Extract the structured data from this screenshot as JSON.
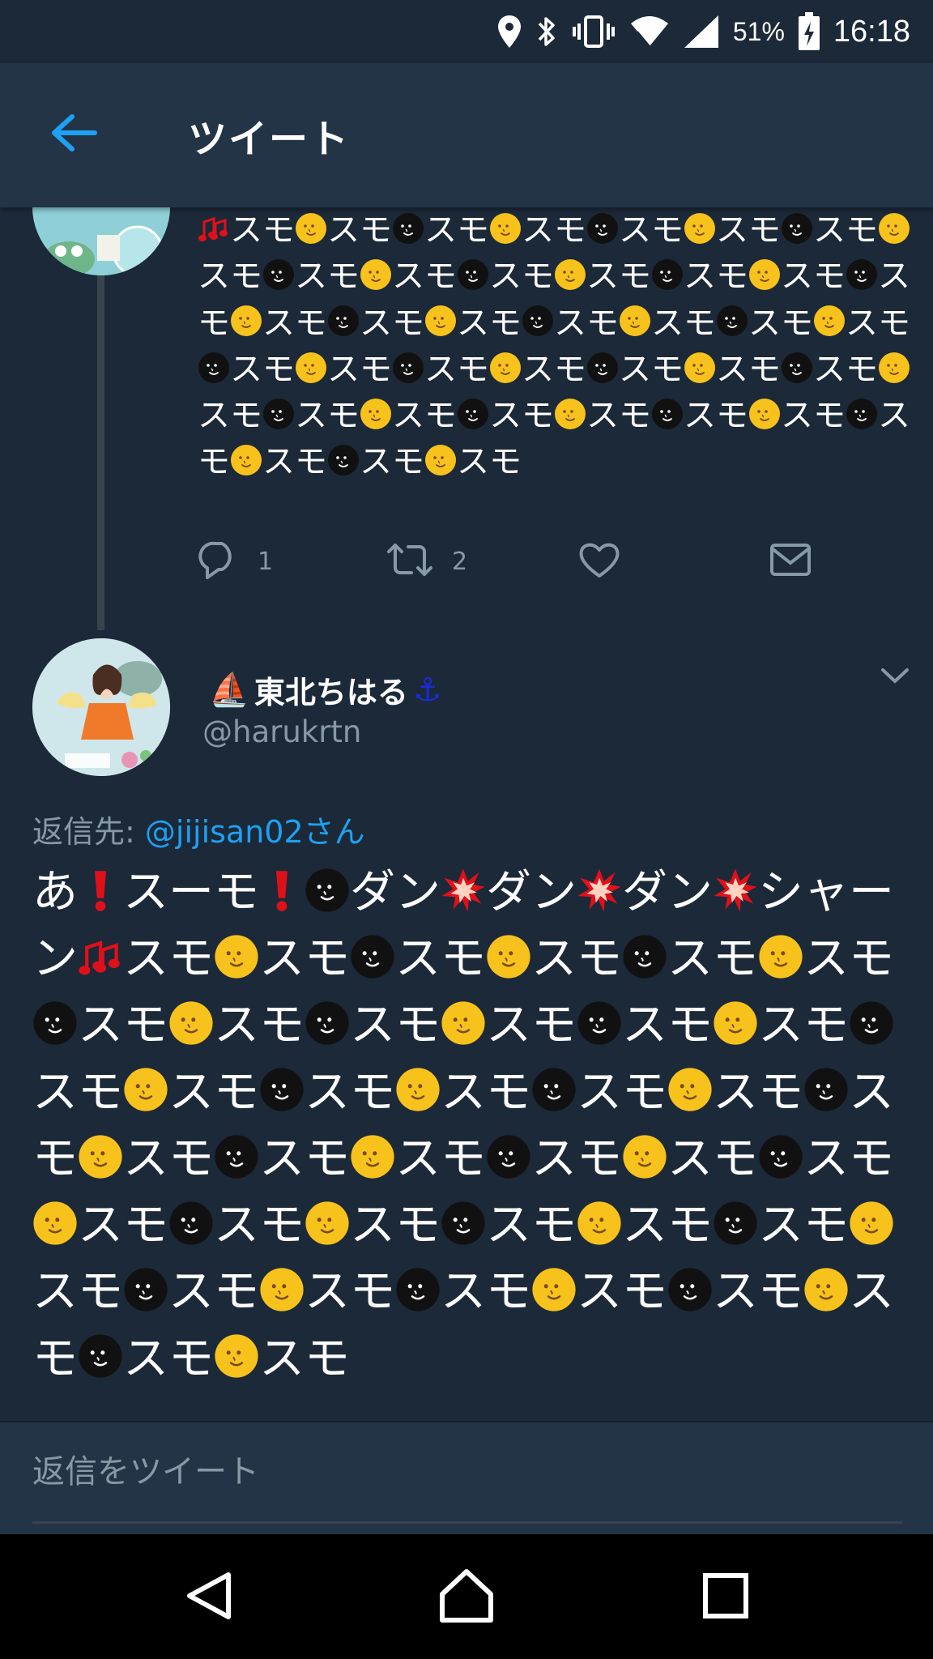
{
  "status_bar": {
    "battery_percent": "51%",
    "time": "16:18",
    "icons": [
      "location-icon",
      "bluetooth-icon",
      "vibrate-icon",
      "wifi-icon",
      "cell-signal-icon",
      "battery-charging-icon"
    ]
  },
  "app_bar": {
    "back_icon": "arrow-left-icon",
    "title": "ツイート"
  },
  "previous_tweet": {
    "text_tokens": [
      "🎶",
      "スモ",
      "🌝",
      "スモ",
      "🌚",
      "スモ",
      "🌝",
      "スモ",
      "🌚",
      "スモ",
      "🌝",
      "スモ",
      "🌚",
      "スモ",
      "🌝",
      "スモ",
      "🌚",
      "スモ",
      "🌝",
      "スモ",
      "🌚",
      "スモ",
      "🌝",
      "スモ",
      "🌚",
      "スモ",
      "🌝",
      "スモ",
      "🌚",
      "スモ",
      "🌝",
      "スモ",
      "🌚",
      "スモ",
      "🌝",
      "スモ",
      "🌚",
      "スモ",
      "🌝",
      "スモ",
      "🌚",
      "スモ",
      "🌝",
      "スモ",
      "🌚",
      "スモ",
      "🌝",
      "スモ",
      "🌚",
      "スモ",
      "🌝",
      "スモ",
      "🌚",
      "スモ",
      "🌝",
      "スモ",
      "🌚",
      "スモ",
      "🌝",
      "スモ",
      "🌚",
      "スモ",
      "🌝",
      "スモ",
      "🌚",
      "スモ",
      "🌝",
      "スモ",
      "🌚",
      "スモ",
      "🌝",
      "スモ",
      "🌚",
      "スモ",
      "🌝",
      "スモ",
      "🌚",
      "スモ",
      "🌝",
      "スモ"
    ],
    "reply_count": "1",
    "retweet_count": "2"
  },
  "main_tweet": {
    "author_name": "東北ちはる",
    "name_prefix_emoji": "⛵",
    "name_suffix_emoji": "⚓",
    "handle": "@harukrtn",
    "reply_to_label": "返信先:",
    "reply_to_user": "@jijisan02さん",
    "text_tokens": [
      "あ",
      "❗",
      "スーモ",
      "❗",
      "🌚",
      "ダン",
      "💥",
      "ダン",
      "💥",
      "ダン",
      "💥",
      "シャーン",
      "🎶",
      "スモ",
      "🌝",
      "スモ",
      "🌚",
      "スモ",
      "🌝",
      "スモ",
      "🌚",
      "スモ",
      "🌝",
      "スモ",
      "🌚",
      "スモ",
      "🌝",
      "スモ",
      "🌚",
      "スモ",
      "🌝",
      "スモ",
      "🌚",
      "スモ",
      "🌝",
      "スモ",
      "🌚",
      "スモ",
      "🌝",
      "スモ",
      "🌚",
      "ス",
      "モ",
      "🌝",
      "スモ",
      "🌚",
      "スモ",
      "🌝",
      "スモ",
      "🌚",
      "スモ",
      "🌝",
      "スモ",
      "🌚",
      "スモ",
      "🌝",
      "スモ",
      "🌚",
      "スモ",
      "🌝",
      "スモ",
      "🌚",
      "スモ",
      "🌝",
      "スモ",
      "🌚",
      "スモ",
      "🌝",
      "スモ",
      "🌚",
      "スモ",
      "🌝",
      "スモ",
      "🌚",
      "ス",
      "モ",
      "🌝",
      "スモ",
      "🌚",
      "スモ",
      "🌝",
      "スモ",
      "🌚",
      "スモ",
      "🌝",
      "スモ",
      "🌚",
      "スモ",
      "🌝",
      "スモ",
      "🌚",
      "スモ",
      "🌝",
      "スモ"
    ]
  },
  "reply_composer": {
    "placeholder": "返信をツイート"
  },
  "nav_bar": {
    "icons": [
      "back-triangle-icon",
      "home-circle-icon",
      "recents-square-icon"
    ]
  },
  "colors": {
    "background": "#1c2938",
    "app_bar": "#243447",
    "accent_blue": "#1da1f2",
    "secondary_text": "#8899a6",
    "moon_yellow": "#f8c21c",
    "moon_dark": "#111111",
    "red": "#e0101a"
  }
}
